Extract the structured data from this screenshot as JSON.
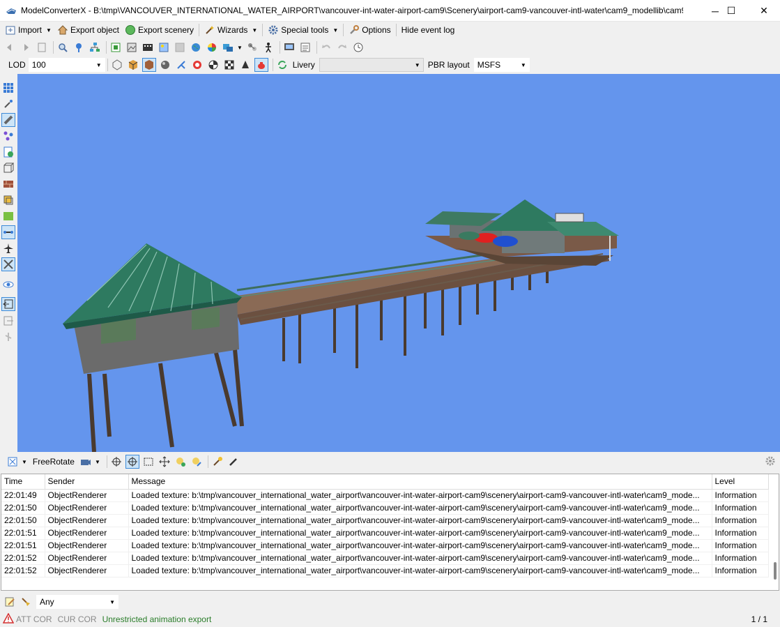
{
  "window": {
    "title": "ModelConverterX - B:\\tmp\\VANCOUVER_INTERNATIONAL_WATER_AIRPORT\\vancouver-int-water-airport-cam9\\Scenery\\airport-cam9-vancouver-intl-water\\cam9_modellib\\cam9...",
    "minimize": "─",
    "maximize": "☐",
    "close": "✕"
  },
  "menu": {
    "import": "Import",
    "export_object": "Export object",
    "export_scenery": "Export scenery",
    "wizards": "Wizards",
    "special_tools": "Special tools",
    "options": "Options",
    "hide_event_log": "Hide event log"
  },
  "lodbar": {
    "lod_label": "LOD",
    "lod_value": "100",
    "livery_label": "Livery",
    "livery_value": "",
    "pbr_label": "PBR layout",
    "pbr_value": "MSFS"
  },
  "viewbar": {
    "mode": "FreeRotate"
  },
  "log": {
    "columns": [
      "Time",
      "Sender",
      "Message",
      "Level"
    ],
    "rows": [
      [
        "22:01:49",
        "ObjectRenderer",
        "Loaded texture: b:\\tmp\\vancouver_international_water_airport\\vancouver-int-water-airport-cam9\\scenery\\airport-cam9-vancouver-intl-water\\cam9_mode...",
        "Information"
      ],
      [
        "22:01:50",
        "ObjectRenderer",
        "Loaded texture: b:\\tmp\\vancouver_international_water_airport\\vancouver-int-water-airport-cam9\\scenery\\airport-cam9-vancouver-intl-water\\cam9_mode...",
        "Information"
      ],
      [
        "22:01:50",
        "ObjectRenderer",
        "Loaded texture: b:\\tmp\\vancouver_international_water_airport\\vancouver-int-water-airport-cam9\\scenery\\airport-cam9-vancouver-intl-water\\cam9_mode...",
        "Information"
      ],
      [
        "22:01:51",
        "ObjectRenderer",
        "Loaded texture: b:\\tmp\\vancouver_international_water_airport\\vancouver-int-water-airport-cam9\\scenery\\airport-cam9-vancouver-intl-water\\cam9_mode...",
        "Information"
      ],
      [
        "22:01:51",
        "ObjectRenderer",
        "Loaded texture: b:\\tmp\\vancouver_international_water_airport\\vancouver-int-water-airport-cam9\\scenery\\airport-cam9-vancouver-intl-water\\cam9_mode...",
        "Information"
      ],
      [
        "22:01:52",
        "ObjectRenderer",
        "Loaded texture: b:\\tmp\\vancouver_international_water_airport\\vancouver-int-water-airport-cam9\\scenery\\airport-cam9-vancouver-intl-water\\cam9_mode...",
        "Information"
      ],
      [
        "22:01:52",
        "ObjectRenderer",
        "Loaded texture: b:\\tmp\\vancouver_international_water_airport\\vancouver-int-water-airport-cam9\\scenery\\airport-cam9-vancouver-intl-water\\cam9_mode...",
        "Information"
      ]
    ]
  },
  "filter": {
    "level": "Any"
  },
  "status": {
    "att_cor": "ATT COR",
    "cur_cor": "CUR COR",
    "animation": "Unrestricted animation export",
    "page": "1 / 1"
  },
  "colors": {
    "viewport_bg": "#6495ed",
    "roof": "#2e7a60",
    "wall": "#6b6b6b",
    "deck": "#8a6a55"
  }
}
